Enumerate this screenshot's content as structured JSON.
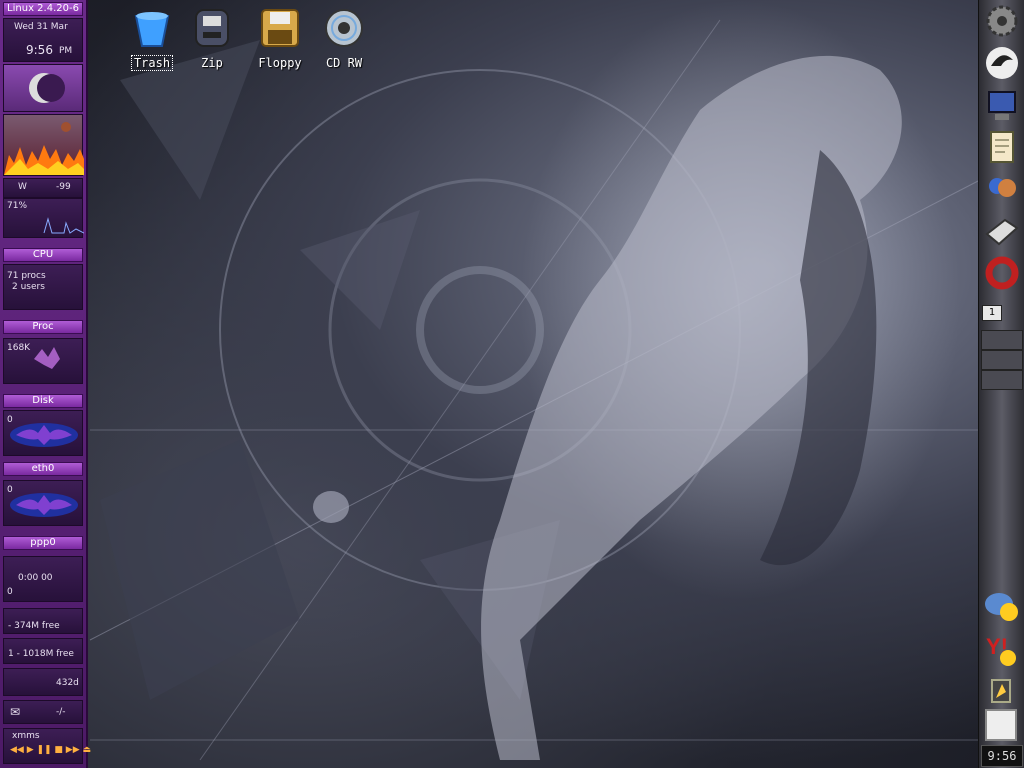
{
  "desktop": {
    "icons": [
      {
        "label": "Trash"
      },
      {
        "label": "Zip"
      },
      {
        "label": "Floppy"
      },
      {
        "label": "CD RW"
      }
    ]
  },
  "gkrellm": {
    "hostname": "Linux 2.4.20-6",
    "date": "Wed 31 Mar",
    "time": "9:56",
    "ampm": "PM",
    "weather_label": "W",
    "weather_value": "-99",
    "cpu_percent": "71%",
    "cpu_label": "CPU",
    "procs": "71 procs",
    "users": "2 users",
    "proc_label": "Proc",
    "disk_rate": "168K",
    "disk_label": "Disk",
    "disk_zero": "0",
    "eth_label": "eth0",
    "eth_zero": "0",
    "ppp_label": "ppp0",
    "ppp_time": "0:00 00",
    "ppp_zero": "0",
    "mem_free": "- 374M free",
    "swap_free": "1 - 1018M free",
    "uptime": "432d",
    "mail_value": "-/-",
    "xmms_label": "xmms"
  },
  "dock": {
    "pager": "1",
    "clock": "9:56"
  },
  "colors": {
    "panel": "#6a2a8a",
    "panel_dark": "#27113a",
    "dock": "#5c5c66"
  }
}
